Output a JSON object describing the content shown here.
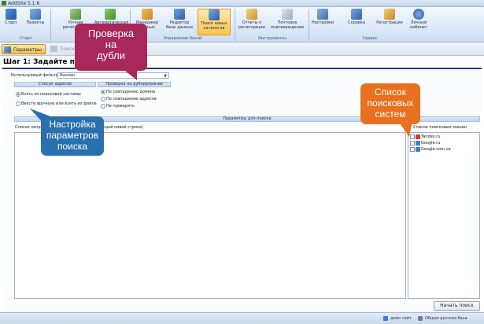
{
  "window": {
    "title": "AddSite 5.1.6"
  },
  "ribbon": {
    "buttons": [
      {
        "label": "Старт"
      },
      {
        "label": "Проекты"
      },
      {
        "label": "Ручная регистрация"
      },
      {
        "label": "Автоматическая"
      },
      {
        "label": "Менеджер данных"
      },
      {
        "label": "Редактор базы данных"
      },
      {
        "label": "Поиск новых каталогов"
      },
      {
        "label": "Отчеты о регистрации"
      },
      {
        "label": "Почтовое подтверждение"
      },
      {
        "label": "Настройки"
      },
      {
        "label": "Справка"
      },
      {
        "label": "Регистрация"
      },
      {
        "label": "Личный кабинет"
      }
    ],
    "groups": [
      "Старт",
      "Управление базой",
      "Инструменты",
      "Сервис"
    ]
  },
  "toolbar2": {
    "tabs": [
      {
        "label": "Параметры"
      },
      {
        "label": "Поиск"
      }
    ]
  },
  "step": {
    "title": "Шаг 1: Задайте параметры"
  },
  "form": {
    "filter_label": "Используемый фильтр",
    "filter_value": "Russian",
    "addresses_header": "Список адресов",
    "addresses_options": [
      {
        "label": "Взять из поисковой системы",
        "checked": true
      },
      {
        "label": "Ввести вручную или взять из файла",
        "checked": false
      }
    ],
    "dup_header": "Проверка на дублирование",
    "dup_options": [
      {
        "label": "По совпадению домена",
        "checked": true
      },
      {
        "label": "По совпадению адресов",
        "checked": false
      },
      {
        "label": "Не проверять",
        "checked": false
      }
    ],
    "search_params_header": "Параметры для поиска",
    "queries_label": "Список запросов (по одному запросу в каждой новой строке)",
    "engines_label": "Список поисковых машин",
    "engines": [
      {
        "name": "Yandex.ru",
        "color": "#d63a2a"
      },
      {
        "name": "Google.ru",
        "color": "#3a7be0"
      },
      {
        "name": "Google.com.ua",
        "color": "#3a7be0"
      }
    ],
    "start_button": "Начать поиск"
  },
  "statusbar": {
    "items": [
      {
        "label": "демо сайт"
      },
      {
        "label": "Общая русская база"
      }
    ]
  },
  "callouts": {
    "dup_check": [
      "Проверка",
      "на",
      "дубли"
    ],
    "search_setup": [
      "Настройка",
      "параметров",
      "поиска"
    ],
    "engines_list": [
      "Список",
      "поисковых",
      "систем"
    ]
  },
  "colors": {
    "callout_red": "#a8285a",
    "callout_blue": "#2a6fae",
    "callout_orange": "#e8701e",
    "accent_navy": "#243d7a"
  }
}
